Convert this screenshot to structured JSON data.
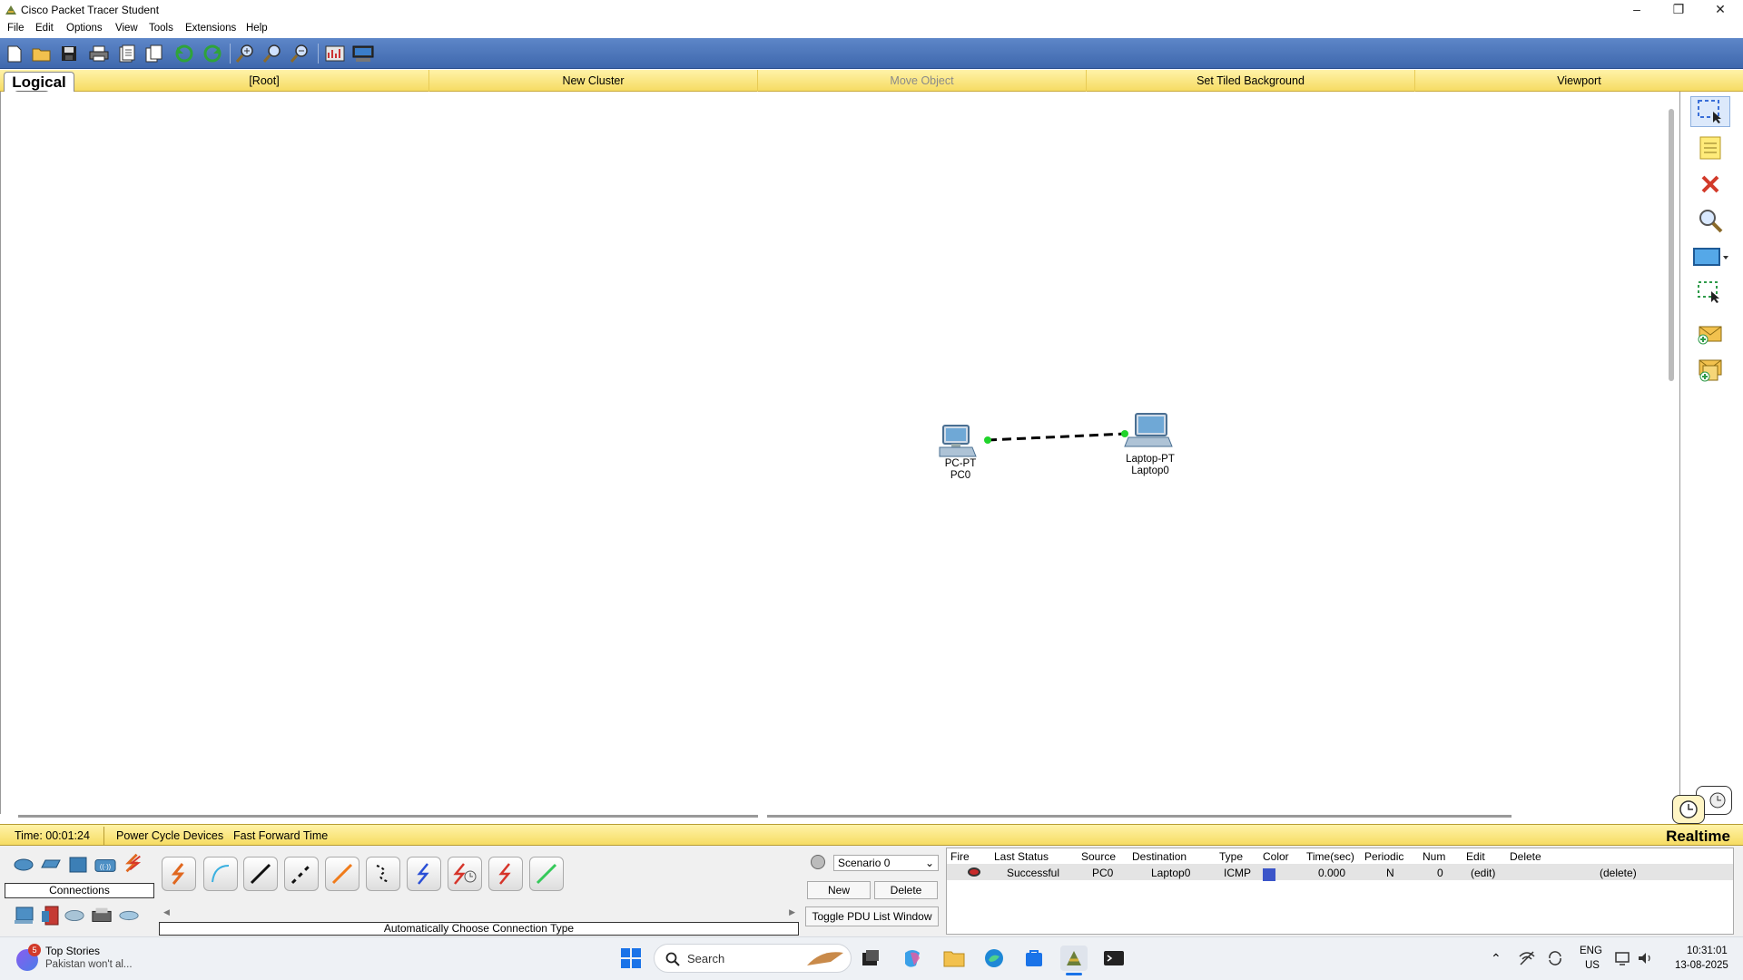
{
  "window": {
    "title": "Cisco Packet Tracer Student"
  },
  "menu": [
    "File",
    "Edit",
    "Options",
    "View",
    "Tools",
    "Extensions",
    "Help"
  ],
  "workspace_bar": {
    "mode_tab": "Logical",
    "items": [
      "[Root]",
      "New Cluster",
      "Move Object",
      "Set Tiled Background",
      "Viewport"
    ]
  },
  "devices": [
    {
      "type": "PC-PT",
      "name": "PC0"
    },
    {
      "type": "Laptop-PT",
      "name": "Laptop0"
    }
  ],
  "status_bar": {
    "time": "Time: 00:01:24",
    "power_cycle": "Power Cycle Devices",
    "fast_forward": "Fast Forward Time",
    "mode": "Realtime"
  },
  "device_panel": {
    "category_label": "Connections",
    "connection_type_label": "Automatically Choose Connection Type"
  },
  "scenario": {
    "selected": "Scenario 0",
    "new_label": "New",
    "delete_label": "Delete",
    "toggle_label": "Toggle PDU List Window"
  },
  "pdu_table": {
    "headers": [
      "Fire",
      "Last Status",
      "Source",
      "Destination",
      "Type",
      "Color",
      "Time(sec)",
      "Periodic",
      "Num",
      "Edit",
      "Delete"
    ],
    "rows": [
      {
        "last_status": "Successful",
        "source": "PC0",
        "destination": "Laptop0",
        "type": "ICMP",
        "color": "#3b55c9",
        "time": "0.000",
        "periodic": "N",
        "num": "0",
        "edit": "(edit)",
        "delete": "(delete)"
      }
    ]
  },
  "taskbar": {
    "news_badge": "5",
    "news_title": "Top Stories",
    "news_text": "Pakistan won't al...",
    "search_placeholder": "Search",
    "lang": "ENG",
    "region": "US",
    "time": "10:31:01",
    "date": "13-08-2025"
  }
}
